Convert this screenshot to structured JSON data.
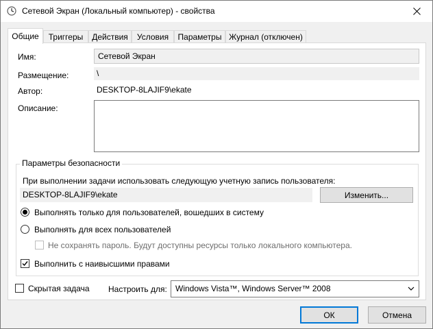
{
  "window": {
    "title": "Сетевой Экран (Локальный компьютер) - свойства",
    "app_icon": "clock-icon",
    "close_icon": "close-icon"
  },
  "tabs": [
    {
      "label": "Общие",
      "active": true
    },
    {
      "label": "Триггеры",
      "active": false
    },
    {
      "label": "Действия",
      "active": false
    },
    {
      "label": "Условия",
      "active": false
    },
    {
      "label": "Параметры",
      "active": false
    },
    {
      "label": "Журнал (отключен)",
      "active": false
    }
  ],
  "general": {
    "name_label": "Имя:",
    "name_value": "Сетевой Экран",
    "location_label": "Размещение:",
    "location_value": "\\",
    "author_label": "Автор:",
    "author_value": "DESKTOP-8LAJIF9\\ekate",
    "description_label": "Описание:",
    "description_value": ""
  },
  "security": {
    "group_title": "Параметры безопасности",
    "run_as_prompt": "При выполнении задачи использовать следующую учетную запись пользователя:",
    "account_value": "DESKTOP-8LAJIF9\\ekate",
    "change_button": "Изменить...",
    "radio_logged_on": "Выполнять только для пользователей, вошедших в систему",
    "radio_logged_on_selected": true,
    "radio_all_users": "Выполнять для всех пользователей",
    "radio_all_users_selected": false,
    "no_store_password": "Не сохранять пароль. Будут доступны ресурсы только локального компьютера.",
    "no_store_password_checked": false,
    "highest_privileges": "Выполнить с наивысшими правами",
    "highest_privileges_checked": true
  },
  "bottom": {
    "hidden_label": "Скрытая задача",
    "hidden_checked": false,
    "configure_label": "Настроить для:",
    "configure_value": "Windows Vista™, Windows Server™ 2008"
  },
  "buttons": {
    "ok": "ОК",
    "cancel": "Отмена"
  },
  "colors": {
    "accent": "#0078d7",
    "dialog_bg": "#f0f0f0",
    "panel_bg": "#ffffff"
  }
}
